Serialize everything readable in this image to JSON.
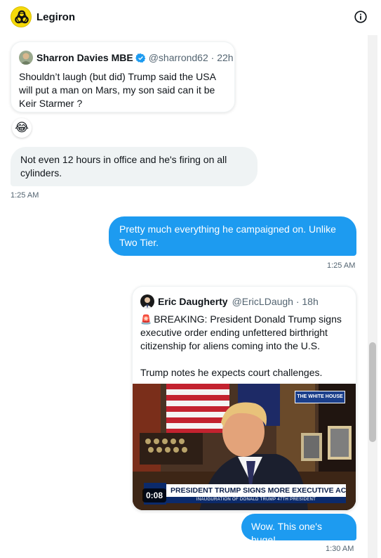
{
  "header": {
    "title": "Legiron",
    "icons": [
      "biohazard-avatar-icon",
      "info-icon"
    ],
    "accent_color": "#1d9bf0"
  },
  "messages": {
    "quote1": {
      "name": "Sharron Davies MBE",
      "handle_time": "@sharrond62 · 22h",
      "text": "Shouldn’t laugh (but did) Trump said the USA will put a man on Mars, my son said can it be Keir Starmer ?"
    },
    "reaction": "😂",
    "msg1": {
      "text": "Not even 12 hours in office and he's firing on all cylinders.",
      "time": "1:25 AM"
    },
    "msg2": {
      "text": "Pretty much everything he campaigned on. Unlike Two Tier.",
      "time": "1:25 AM"
    },
    "quote2": {
      "name": "Eric Daugherty",
      "handle_time": "@EricLDaugh · 18h",
      "siren": "🚨",
      "text1": "BREAKING: President Donald Trump signs executive order ending unfettered birthright citizenship for aliens coming into the U.S.",
      "text2": "Trump notes he expects court challenges.",
      "video": {
        "bug": "THE WHITE HOUSE",
        "chyron": "PRESIDENT TRUMP SIGNS MORE EXECUTIVE ACTIONS",
        "chyron_sub": "INAUGURATION OF DONALD TRUMP 47TH PRESIDENT",
        "duration": "0:08"
      }
    },
    "msg3": {
      "text": "Wow. This one's huge!",
      "time": "1:30 AM"
    }
  }
}
